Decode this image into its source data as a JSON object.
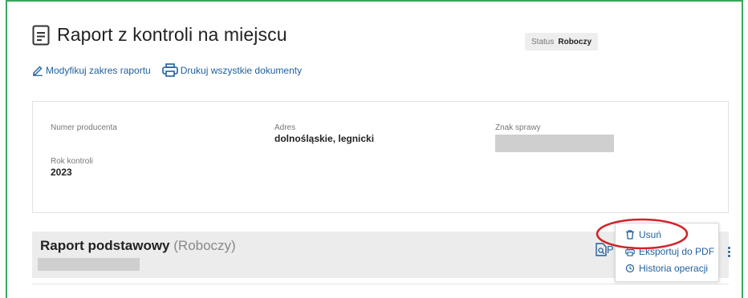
{
  "page": {
    "title": "Raport z kontroli na miejscu",
    "status_label": "Status",
    "status_value": "Roboczy"
  },
  "actions": [
    {
      "label": "Modyfikuj zakres raportu",
      "icon": "pencil-icon"
    },
    {
      "label": "Drukuj wszystkie dokumenty",
      "icon": "printer-icon"
    }
  ],
  "details": {
    "producer_number_label": "Numer producenta",
    "address_label": "Adres",
    "address_value": "dolnośląskie, legnicki",
    "case_label": "Znak sprawy",
    "year_label": "Rok kontroli",
    "year_value": "2023"
  },
  "report": {
    "title": "Raport podstawowy",
    "status": "(Roboczy)",
    "preview_label": "P"
  },
  "menu": {
    "delete": "Usuń",
    "export_pdf": "Eksportuj do PDF",
    "history": "Historia operacji"
  },
  "colors": {
    "frame": "#37a85a",
    "link": "#1f5f9e",
    "annotation": "#d1232a"
  }
}
